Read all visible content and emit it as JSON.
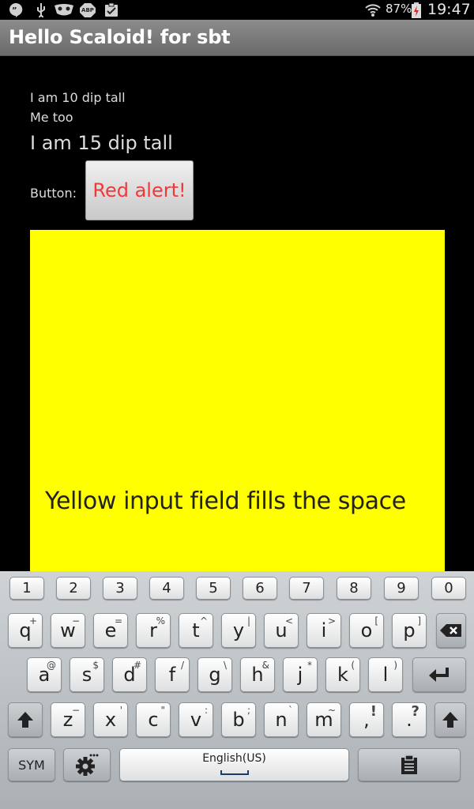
{
  "status_bar": {
    "icons": [
      "hangouts-icon",
      "usb-icon",
      "mask-icon",
      "adblock-icon",
      "clipboard-check-icon",
      "wifi-icon",
      "battery-icon"
    ],
    "adblock_text": "ABP",
    "battery_percent": "87%",
    "time": "19:47"
  },
  "title_bar": {
    "title": "Hello Scaloid! for sbt"
  },
  "content": {
    "line1": "I am 10 dip tall",
    "line2": "Me too",
    "line3": "I am 15 dip tall",
    "button_label": "Button:",
    "button_text": "Red alert!",
    "input_text": "Yellow input field fills the space",
    "colors": {
      "input_background": "#ffff00",
      "alert_text": "#f03a3a"
    }
  },
  "keyboard": {
    "numbers": [
      "1",
      "2",
      "3",
      "4",
      "5",
      "6",
      "7",
      "8",
      "9",
      "0"
    ],
    "row1": [
      {
        "main": "q",
        "sub": "+"
      },
      {
        "main": "w",
        "sub": "−"
      },
      {
        "main": "e",
        "sub": "="
      },
      {
        "main": "r",
        "sub": "%"
      },
      {
        "main": "t",
        "sub": "^"
      },
      {
        "main": "y",
        "sub": "|"
      },
      {
        "main": "u",
        "sub": "<"
      },
      {
        "main": "i",
        "sub": ">"
      },
      {
        "main": "o",
        "sub": "["
      },
      {
        "main": "p",
        "sub": "]"
      }
    ],
    "row2": [
      {
        "main": "a",
        "sub": "@"
      },
      {
        "main": "s",
        "sub": "$"
      },
      {
        "main": "d",
        "sub": "#"
      },
      {
        "main": "f",
        "sub": "/"
      },
      {
        "main": "g",
        "sub": "\\"
      },
      {
        "main": "h",
        "sub": "&"
      },
      {
        "main": "j",
        "sub": "*"
      },
      {
        "main": "k",
        "sub": "("
      },
      {
        "main": "l",
        "sub": ")"
      }
    ],
    "row3": [
      {
        "main": "z",
        "sub": "−"
      },
      {
        "main": "x",
        "sub": "'"
      },
      {
        "main": "c",
        "sub": "\""
      },
      {
        "main": "v",
        "sub": ":"
      },
      {
        "main": "b",
        "sub": ";"
      },
      {
        "main": "n",
        "sub": "`"
      },
      {
        "main": "m",
        "sub": "~"
      },
      {
        "main": ",",
        "sub": "!"
      },
      {
        "main": ".",
        "sub": "?"
      }
    ],
    "sym_label": "SYM",
    "space_label": "English(US)",
    "special_icons": [
      "backspace-icon",
      "enter-icon",
      "shift-icon",
      "settings-icon",
      "clipboard-icon"
    ]
  }
}
